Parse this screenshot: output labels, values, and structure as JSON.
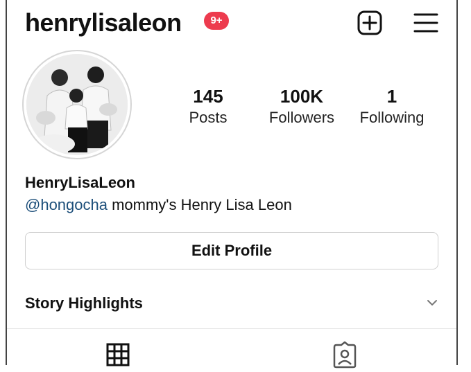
{
  "header": {
    "username": "henrylisaleon",
    "notification_badge": "9+",
    "add_icon": "plus-square-icon",
    "menu_icon": "hamburger-menu-icon"
  },
  "profile": {
    "posts_count": "145",
    "posts_label": "Posts",
    "followers_count": "100K",
    "followers_label": "Followers",
    "following_count": "1",
    "following_label": "Following",
    "display_name": "HenryLisaLeon",
    "bio_mention": "@hongocha",
    "bio_text": " mommy's Henry Lisa Leon"
  },
  "actions": {
    "edit_profile_label": "Edit Profile"
  },
  "highlights": {
    "title": "Story Highlights",
    "toggle_icon": "chevron-down-icon"
  },
  "tabs": {
    "grid_icon": "grid-icon",
    "tagged_icon": "tagged-person-icon"
  },
  "colors": {
    "badge": "#ed3b4e",
    "mention": "#1d4f7a",
    "text": "#111111"
  }
}
